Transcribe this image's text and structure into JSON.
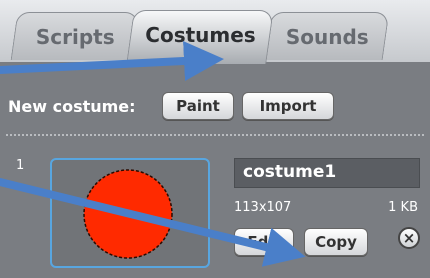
{
  "tabs": [
    {
      "label": "Scripts",
      "active": false
    },
    {
      "label": "Costumes",
      "active": true
    },
    {
      "label": "Sounds",
      "active": false
    }
  ],
  "new_costume": {
    "label": "New costume:",
    "paint_button": "Paint",
    "import_button": "Import"
  },
  "costume": {
    "number": "1",
    "name": "costume1",
    "dimensions": "113x107",
    "size": "1 KB",
    "edit_button": "Edit",
    "copy_button": "Copy",
    "delete_icon": "close-icon"
  },
  "colors": {
    "costume_fill": "#ff2a00",
    "arrow": "#4a7fc9",
    "selection_border": "#58a6e0"
  }
}
